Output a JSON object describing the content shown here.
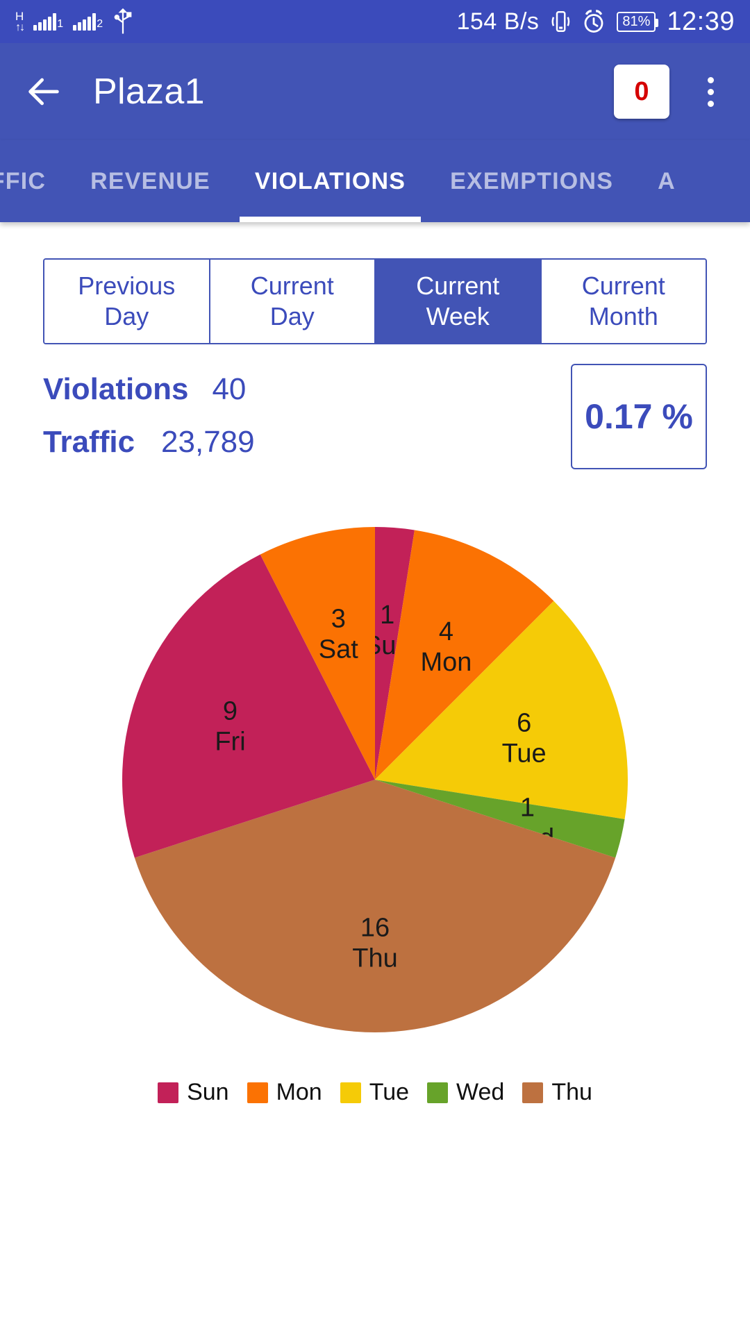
{
  "statusbar": {
    "network_type": "H",
    "data_rate": "154 B/s",
    "battery": "81%",
    "time": "12:39",
    "icons": [
      "hspa-icon",
      "signal-bars-1-icon",
      "signal-bars-2-icon",
      "usb-icon",
      "vibrate-icon",
      "alarm-icon",
      "battery-icon"
    ]
  },
  "appbar": {
    "back_icon": "back-arrow-icon",
    "title": "Plaza1",
    "badge_count": "0",
    "badge_color": "#d50000",
    "overflow_icon": "more-vertical-icon",
    "background": "#4254b5"
  },
  "tabs": [
    {
      "label": "AFFIC",
      "active": false
    },
    {
      "label": "REVENUE",
      "active": false
    },
    {
      "label": "VIOLATIONS",
      "active": true
    },
    {
      "label": "EXEMPTIONS",
      "active": false
    },
    {
      "label": "A",
      "active": false
    }
  ],
  "period_selector": [
    {
      "line1": "Previous",
      "line2": "Day",
      "active": false
    },
    {
      "line1": "Current",
      "line2": "Day",
      "active": false
    },
    {
      "line1": "Current",
      "line2": "Week",
      "active": true
    },
    {
      "line1": "Current",
      "line2": "Month",
      "active": false
    }
  ],
  "stats": {
    "violations_label": "Violations",
    "violations_value": "40",
    "traffic_label": "Traffic",
    "traffic_value": "23,789",
    "percentage": "0.17 %",
    "accent_color": "#3b4bbb"
  },
  "chart_data": {
    "type": "pie",
    "title": "",
    "categories": [
      "Sun",
      "Mon",
      "Tue",
      "Wed",
      "Thu",
      "Fri",
      "Sat"
    ],
    "values": [
      1,
      4,
      6,
      1,
      16,
      9,
      3
    ],
    "total": 40,
    "colors": [
      "#c22158",
      "#fb7203",
      "#f5cb07",
      "#67a32a",
      "#bd7140",
      "#c22158",
      "#fb7203"
    ],
    "labels": [
      {
        "day": "Sun",
        "value": "1",
        "color": "#c22158"
      },
      {
        "day": "Mon",
        "value": "4",
        "color": "#fb7203"
      },
      {
        "day": "Tue",
        "value": "6",
        "color": "#f5cb07"
      },
      {
        "day": "Wed",
        "value": "1",
        "color": "#67a32a"
      },
      {
        "day": "Thu",
        "value": "16",
        "color": "#bd7140"
      },
      {
        "day": "Fri",
        "value": "9",
        "color": "#c22158"
      },
      {
        "day": "Sat",
        "value": "3",
        "color": "#fb7203"
      }
    ],
    "legend_position": "bottom",
    "legend": [
      {
        "label": "Sun",
        "color": "#c22158"
      },
      {
        "label": "Mon",
        "color": "#fb7203"
      },
      {
        "label": "Tue",
        "color": "#f5cb07"
      },
      {
        "label": "Wed",
        "color": "#67a32a"
      },
      {
        "label": "Thu",
        "color": "#bd7140"
      }
    ]
  }
}
